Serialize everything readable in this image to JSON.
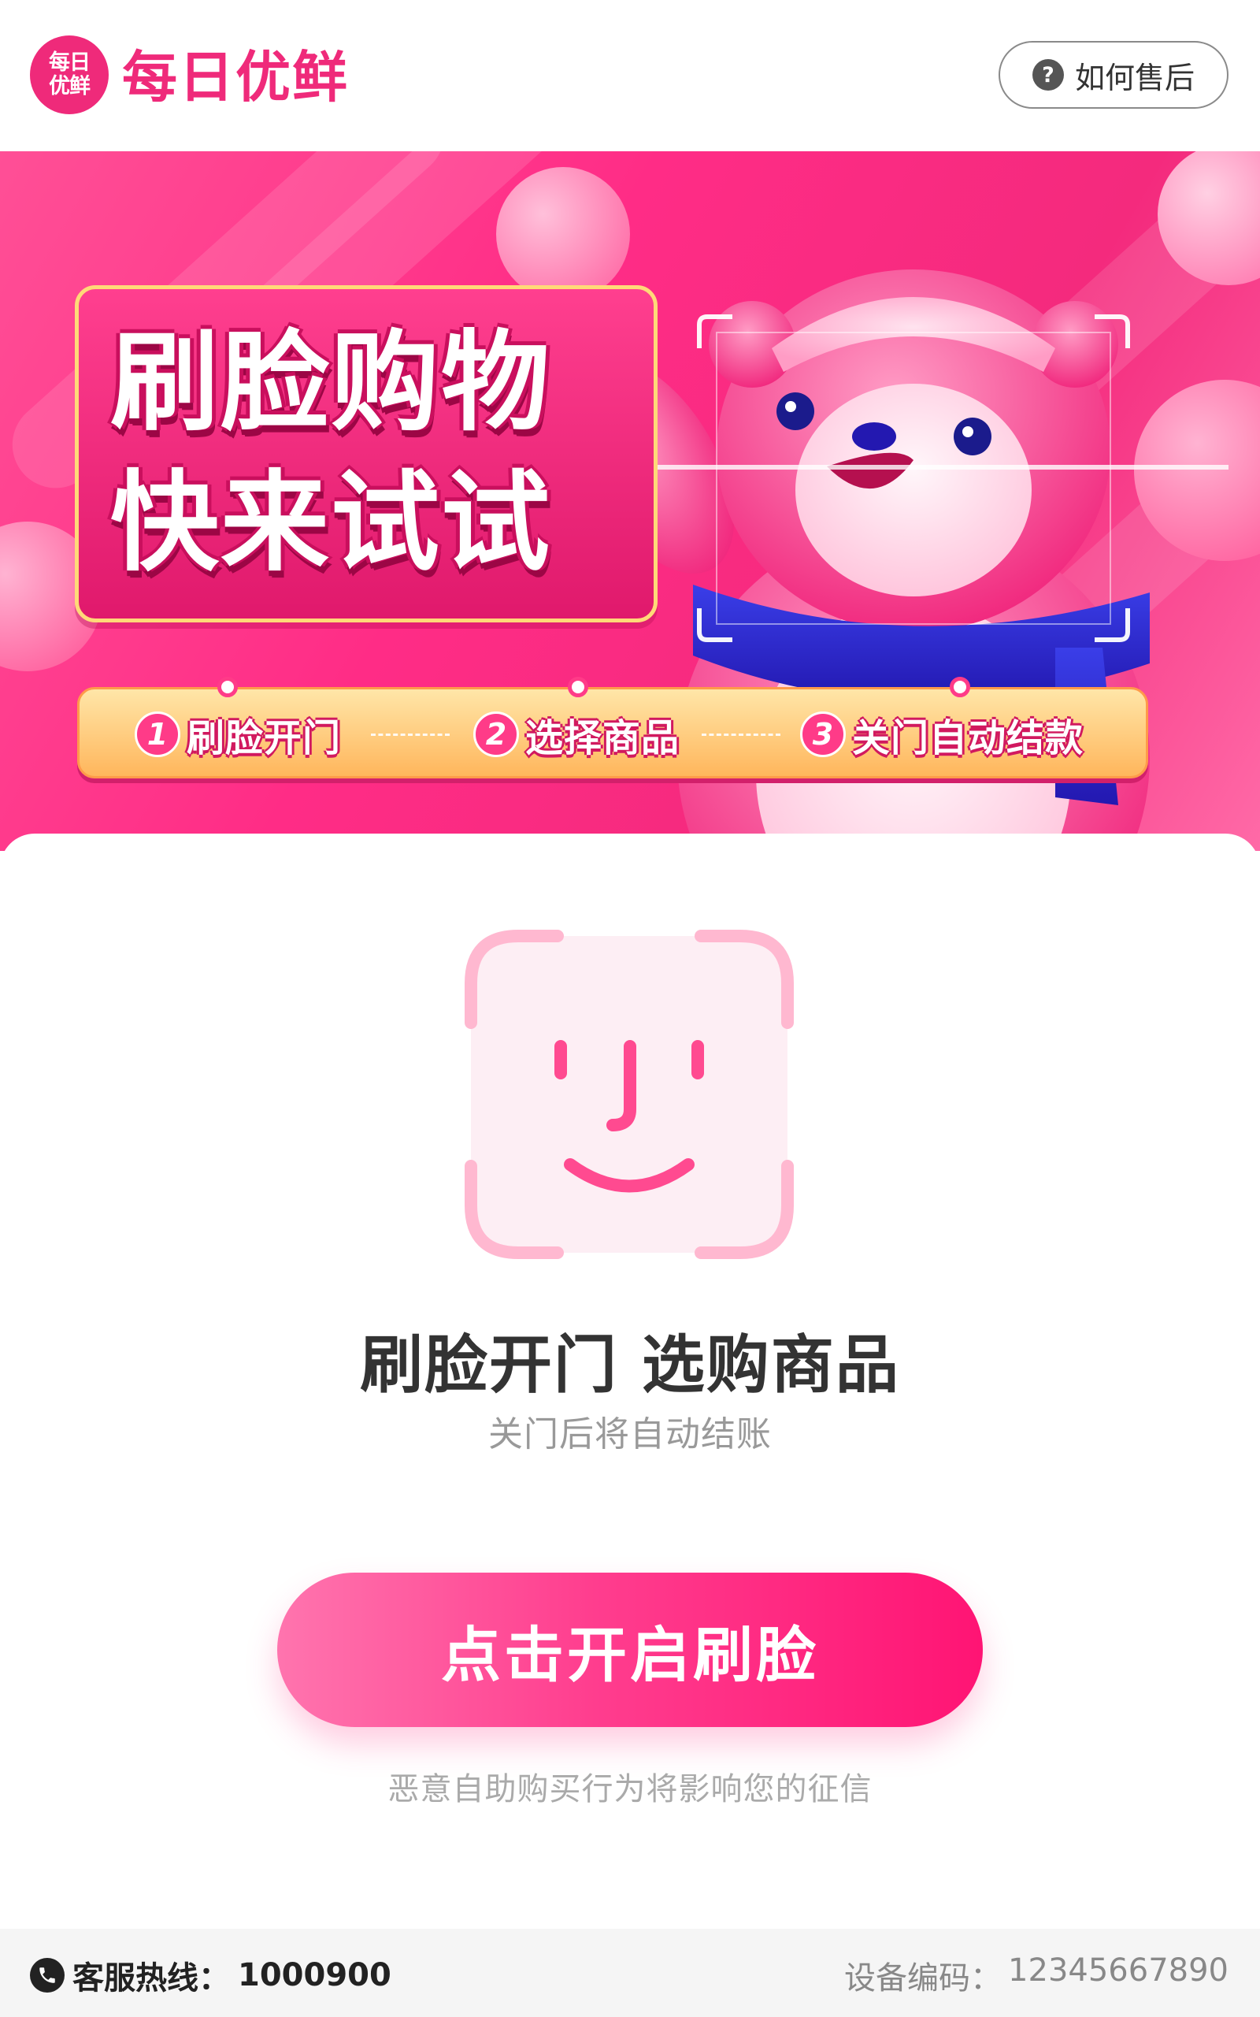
{
  "header": {
    "logo_text_top": "每日",
    "logo_text_bottom": "优鲜",
    "brand_name": "每日优鲜",
    "help_label": "如何售后",
    "help_icon": "question-circle-icon"
  },
  "banner": {
    "title_line1": "刷脸购物",
    "title_line2": "快来试试",
    "steps": [
      {
        "num": "1",
        "label": "刷脸开门"
      },
      {
        "num": "2",
        "label": "选择商品"
      },
      {
        "num": "3",
        "label": "关门自动结款"
      }
    ],
    "mascot": "pink-bear-with-blue-scarf"
  },
  "main": {
    "icon": "face-scan-icon",
    "title": "刷脸开门 选购商品",
    "subtitle": "关门后将自动结账",
    "button_label": "点击开启刷脸",
    "warning": "恶意自助购买行为将影响您的征信"
  },
  "footer": {
    "hotline_icon": "phone-icon",
    "hotline_label": "客服热线：",
    "hotline_number": "1000900",
    "device_label": "设备编码：",
    "device_code": "12345667890"
  },
  "colors": {
    "brand": "#ef2a7a",
    "button_start": "#ff74ae",
    "button_end": "#ff1474",
    "step_bar": "#ffb65c"
  }
}
